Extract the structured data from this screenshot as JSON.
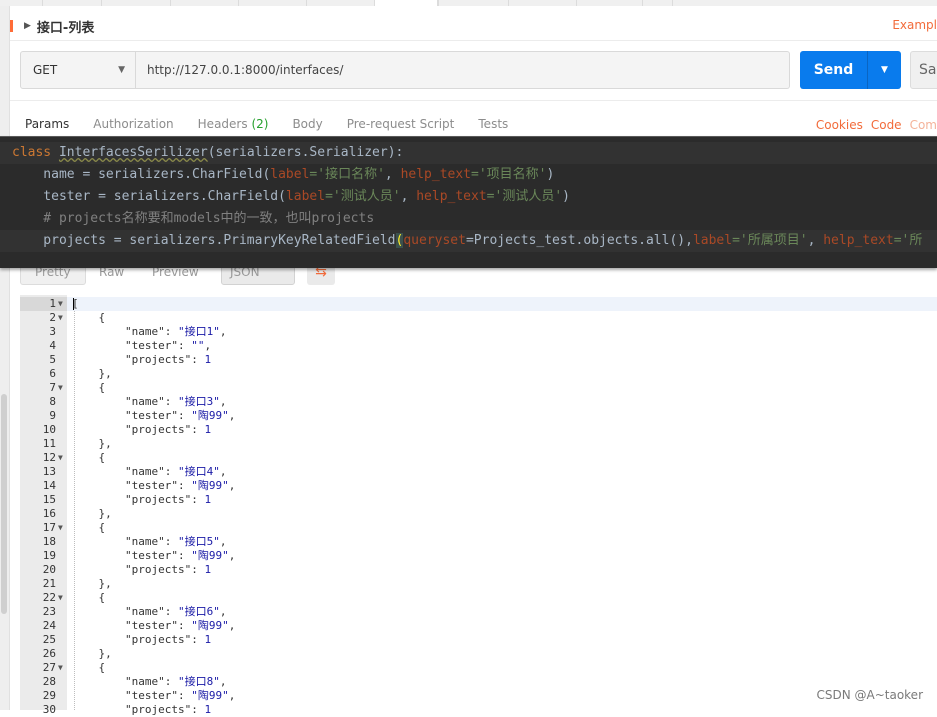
{
  "tab": {
    "title": "接口-列表",
    "right_link": "Exampl"
  },
  "request": {
    "method": "GET",
    "url": "http://127.0.0.1:8000/interfaces/",
    "send_label": "Send",
    "save_label": "Sav"
  },
  "request_tabs": [
    {
      "label": "Params",
      "count": ""
    },
    {
      "label": "Authorization",
      "count": ""
    },
    {
      "label": "Headers",
      "count": "(2)"
    },
    {
      "label": "Body",
      "count": ""
    },
    {
      "label": "Pre-request Script",
      "count": ""
    },
    {
      "label": "Tests",
      "count": ""
    }
  ],
  "right_links": {
    "cookies": "Cookies",
    "code": "Code",
    "comments": "Com"
  },
  "response_bar": {
    "pretty": "Pretty",
    "raw": "Raw",
    "preview": "Preview",
    "format": "JSON"
  },
  "code_overlay": {
    "l1": {
      "kw": "class",
      "cls": "InterfacesSerilizer",
      "rest": "(serializers.Serializer):"
    },
    "l2": {
      "a": "    name = serializers.CharField(",
      "p1": "label",
      "s1": "='接口名称'",
      "c": ", ",
      "p2": "help_text",
      "s2": "='项目名称'",
      "e": ")"
    },
    "l3": {
      "a": "    tester = serializers.CharField(",
      "p1": "label",
      "s1": "='测试人员'",
      "c": ", ",
      "p2": "help_text",
      "s2": "='测试人员'",
      "e": ")"
    },
    "l4": "    # projects名称要和models中的一致，也叫projects",
    "l5": {
      "a": "    projects = serializers.PrimaryKeyRelatedField",
      "paren": "(",
      "p1": "queryset",
      "b": "=Projects_test.objects.all()",
      "c": ",",
      "p2": "label",
      "s1": "='所属项目'",
      "d": ", ",
      "p3": "help_text",
      "s2": "='所"
    }
  },
  "response_lines": [
    {
      "n": "1",
      "fold": true,
      "text": "["
    },
    {
      "n": "2",
      "fold": true,
      "text": "    {"
    },
    {
      "n": "3",
      "key": "\"name\"",
      "val": "\"接口1\"",
      "tail": ","
    },
    {
      "n": "4",
      "key": "\"tester\"",
      "val": "\"\"",
      "tail": ","
    },
    {
      "n": "5",
      "key": "\"projects\"",
      "val": "1",
      "tail": ""
    },
    {
      "n": "6",
      "text": "    },"
    },
    {
      "n": "7",
      "fold": true,
      "text": "    {"
    },
    {
      "n": "8",
      "key": "\"name\"",
      "val": "\"接口3\"",
      "tail": ","
    },
    {
      "n": "9",
      "key": "\"tester\"",
      "val": "\"陶99\"",
      "tail": ","
    },
    {
      "n": "10",
      "key": "\"projects\"",
      "val": "1",
      "tail": ""
    },
    {
      "n": "11",
      "text": "    },"
    },
    {
      "n": "12",
      "fold": true,
      "text": "    {"
    },
    {
      "n": "13",
      "key": "\"name\"",
      "val": "\"接口4\"",
      "tail": ","
    },
    {
      "n": "14",
      "key": "\"tester\"",
      "val": "\"陶99\"",
      "tail": ","
    },
    {
      "n": "15",
      "key": "\"projects\"",
      "val": "1",
      "tail": ""
    },
    {
      "n": "16",
      "text": "    },"
    },
    {
      "n": "17",
      "fold": true,
      "text": "    {"
    },
    {
      "n": "18",
      "key": "\"name\"",
      "val": "\"接口5\"",
      "tail": ","
    },
    {
      "n": "19",
      "key": "\"tester\"",
      "val": "\"陶99\"",
      "tail": ","
    },
    {
      "n": "20",
      "key": "\"projects\"",
      "val": "1",
      "tail": ""
    },
    {
      "n": "21",
      "text": "    },"
    },
    {
      "n": "22",
      "fold": true,
      "text": "    {"
    },
    {
      "n": "23",
      "key": "\"name\"",
      "val": "\"接口6\"",
      "tail": ","
    },
    {
      "n": "24",
      "key": "\"tester\"",
      "val": "\"陶99\"",
      "tail": ","
    },
    {
      "n": "25",
      "key": "\"projects\"",
      "val": "1",
      "tail": ""
    },
    {
      "n": "26",
      "text": "    },"
    },
    {
      "n": "27",
      "fold": true,
      "text": "    {"
    },
    {
      "n": "28",
      "key": "\"name\"",
      "val": "\"接口8\"",
      "tail": ","
    },
    {
      "n": "29",
      "key": "\"tester\"",
      "val": "\"陶99\"",
      "tail": ","
    },
    {
      "n": "30",
      "key": "\"projects\"",
      "val": "1",
      "tail": ""
    }
  ],
  "watermark": "CSDN @A~taoker"
}
